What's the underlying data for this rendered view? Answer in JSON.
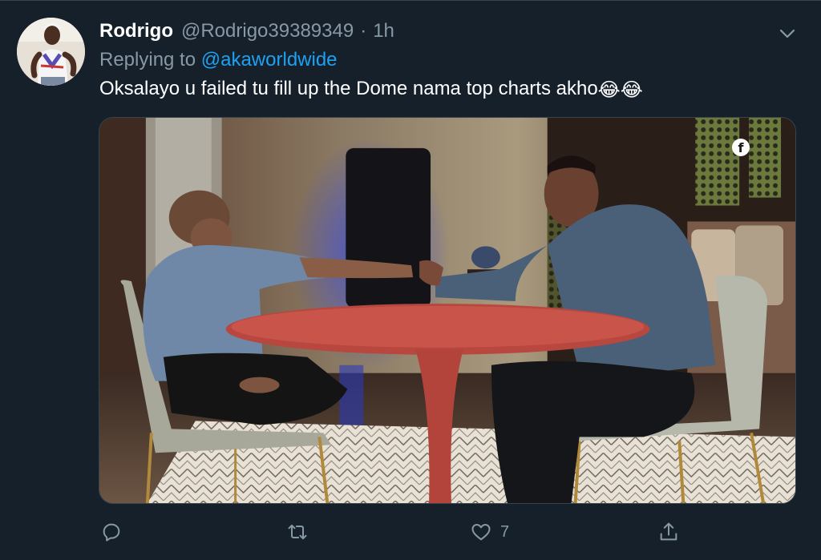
{
  "tweet": {
    "author": {
      "display_name": "Rodrigo",
      "handle": "@Rodrigo39389349",
      "separator": "·",
      "time": "1h"
    },
    "replying": {
      "prefix": "Replying to ",
      "mention": "@akaworldwide"
    },
    "text": "Oksalayo u failed tu fill up the Dome nama top charts akho",
    "emojis": [
      "😂",
      "😂"
    ],
    "media": {
      "badge": "f"
    },
    "actions": {
      "reply_count": "",
      "retweet_count": "",
      "like_count": "7",
      "share_count": ""
    }
  },
  "colors": {
    "background": "#15202b",
    "secondary_text": "#8899a6",
    "link": "#1da1f2",
    "divider": "#38444d"
  }
}
